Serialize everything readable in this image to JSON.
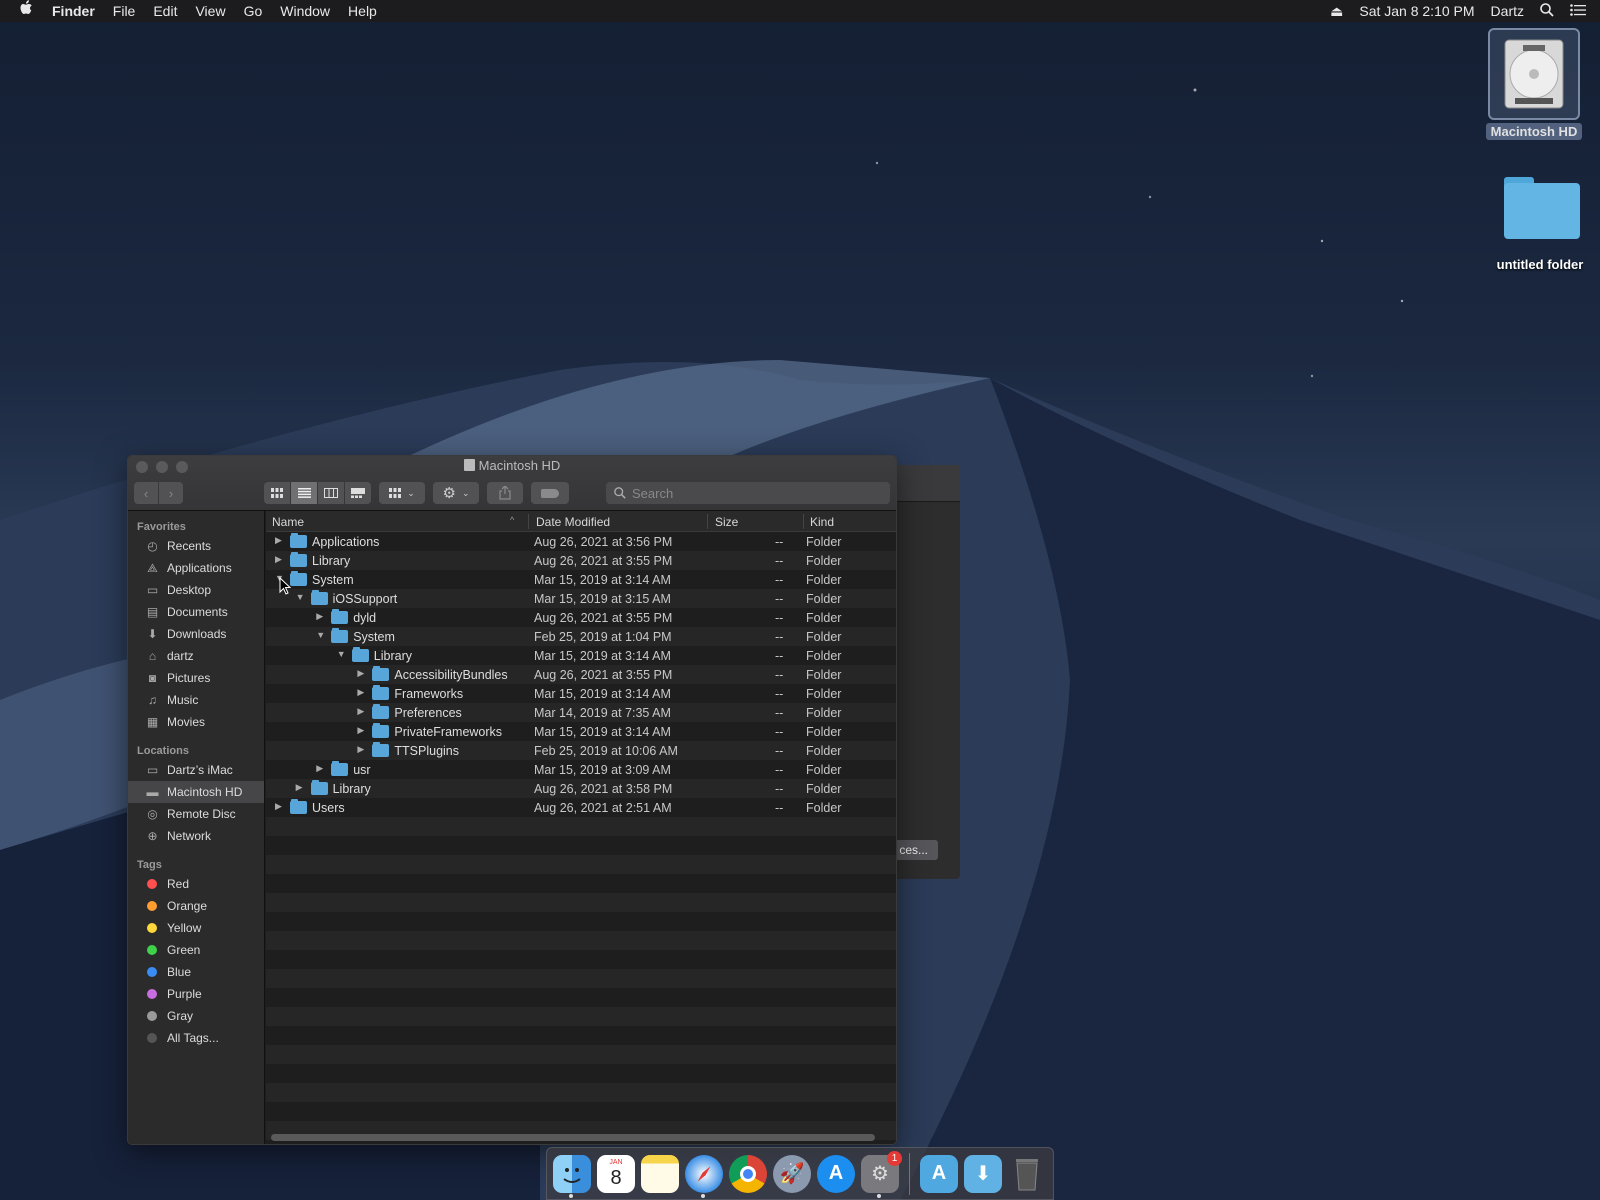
{
  "menubar": {
    "items": [
      "Finder",
      "File",
      "Edit",
      "View",
      "Go",
      "Window",
      "Help"
    ],
    "date_time": "Sat Jan 8  2:10 PM",
    "user": "Dartz",
    "icons": [
      "apple-icon",
      "eject-icon",
      "spotlight-icon",
      "notification-center-icon"
    ]
  },
  "desktop": {
    "items": [
      {
        "label": "Macintosh HD",
        "icon": "hard-drive-icon"
      },
      {
        "label": "untitled folder",
        "icon": "folder-icon"
      }
    ]
  },
  "back_window": {
    "button_label": "ces..."
  },
  "finder": {
    "title": "Macintosh HD",
    "search_placeholder": "Search",
    "columns": {
      "name": "Name",
      "date": "Date Modified",
      "size": "Size",
      "kind": "Kind"
    },
    "sidebar": {
      "favorites_label": "Favorites",
      "favorites": [
        {
          "label": "Recents",
          "icon": "recents-icon"
        },
        {
          "label": "Applications",
          "icon": "applications-icon"
        },
        {
          "label": "Desktop",
          "icon": "desktop-icon"
        },
        {
          "label": "Documents",
          "icon": "documents-icon"
        },
        {
          "label": "Downloads",
          "icon": "downloads-icon"
        },
        {
          "label": "dartz",
          "icon": "home-icon"
        },
        {
          "label": "Pictures",
          "icon": "pictures-icon"
        },
        {
          "label": "Music",
          "icon": "music-icon"
        },
        {
          "label": "Movies",
          "icon": "movies-icon"
        }
      ],
      "locations_label": "Locations",
      "locations": [
        {
          "label": "Dartz’s iMac",
          "icon": "imac-icon"
        },
        {
          "label": "Macintosh HD",
          "icon": "hard-drive-icon",
          "selected": true
        },
        {
          "label": "Remote Disc",
          "icon": "disc-icon"
        },
        {
          "label": "Network",
          "icon": "network-icon"
        }
      ],
      "tags_label": "Tags",
      "tags": [
        {
          "label": "Red",
          "color": "#ff4f4f"
        },
        {
          "label": "Orange",
          "color": "#ff9d2f"
        },
        {
          "label": "Yellow",
          "color": "#ffd83a"
        },
        {
          "label": "Green",
          "color": "#3ed14a"
        },
        {
          "label": "Blue",
          "color": "#3a8cf5"
        },
        {
          "label": "Purple",
          "color": "#c86de0"
        },
        {
          "label": "Gray",
          "color": "#9a9a9a"
        },
        {
          "label": "All Tags...",
          "color": "#555555"
        }
      ]
    },
    "rows": [
      {
        "name": "Applications",
        "date": "Aug 26, 2021 at 3:56 PM",
        "size": "--",
        "kind": "Folder",
        "level": 0,
        "expanded": false
      },
      {
        "name": "Library",
        "date": "Aug 26, 2021 at 3:55 PM",
        "size": "--",
        "kind": "Folder",
        "level": 0,
        "expanded": false
      },
      {
        "name": "System",
        "date": "Mar 15, 2019 at 3:14 AM",
        "size": "--",
        "kind": "Folder",
        "level": 0,
        "expanded": true
      },
      {
        "name": "iOSSupport",
        "date": "Mar 15, 2019 at 3:15 AM",
        "size": "--",
        "kind": "Folder",
        "level": 1,
        "expanded": true
      },
      {
        "name": "dyld",
        "date": "Aug 26, 2021 at 3:55 PM",
        "size": "--",
        "kind": "Folder",
        "level": 2,
        "expanded": false
      },
      {
        "name": "System",
        "date": "Feb 25, 2019 at 1:04 PM",
        "size": "--",
        "kind": "Folder",
        "level": 2,
        "expanded": true
      },
      {
        "name": "Library",
        "date": "Mar 15, 2019 at 3:14 AM",
        "size": "--",
        "kind": "Folder",
        "level": 3,
        "expanded": true
      },
      {
        "name": "AccessibilityBundles",
        "date": "Aug 26, 2021 at 3:55 PM",
        "size": "--",
        "kind": "Folder",
        "level": 4,
        "expanded": false
      },
      {
        "name": "Frameworks",
        "date": "Mar 15, 2019 at 3:14 AM",
        "size": "--",
        "kind": "Folder",
        "level": 4,
        "expanded": false
      },
      {
        "name": "Preferences",
        "date": "Mar 14, 2019 at 7:35 AM",
        "size": "--",
        "kind": "Folder",
        "level": 4,
        "expanded": false
      },
      {
        "name": "PrivateFrameworks",
        "date": "Mar 15, 2019 at 3:14 AM",
        "size": "--",
        "kind": "Folder",
        "level": 4,
        "expanded": false
      },
      {
        "name": "TTSPlugins",
        "date": "Feb 25, 2019 at 10:06 AM",
        "size": "--",
        "kind": "Folder",
        "level": 4,
        "expanded": false
      },
      {
        "name": "usr",
        "date": "Mar 15, 2019 at 3:09 AM",
        "size": "--",
        "kind": "Folder",
        "level": 2,
        "expanded": false
      },
      {
        "name": "Library",
        "date": "Aug 26, 2021 at 3:58 PM",
        "size": "--",
        "kind": "Folder",
        "level": 1,
        "expanded": false
      },
      {
        "name": "Users",
        "date": "Aug 26, 2021 at 2:51 AM",
        "size": "--",
        "kind": "Folder",
        "level": 0,
        "expanded": false
      }
    ]
  },
  "dock": {
    "apps": [
      {
        "name": "finder-icon",
        "running": true
      },
      {
        "name": "calendar-icon",
        "text": "8",
        "month": "JAN"
      },
      {
        "name": "notes-icon"
      },
      {
        "name": "safari-icon",
        "running": true
      },
      {
        "name": "chrome-icon"
      },
      {
        "name": "launchpad-icon"
      },
      {
        "name": "app-store-icon"
      },
      {
        "name": "system-preferences-icon",
        "badge": "1",
        "running": true
      }
    ],
    "others": [
      {
        "name": "applications-folder-icon"
      },
      {
        "name": "downloads-folder-icon"
      },
      {
        "name": "trash-icon"
      }
    ]
  }
}
